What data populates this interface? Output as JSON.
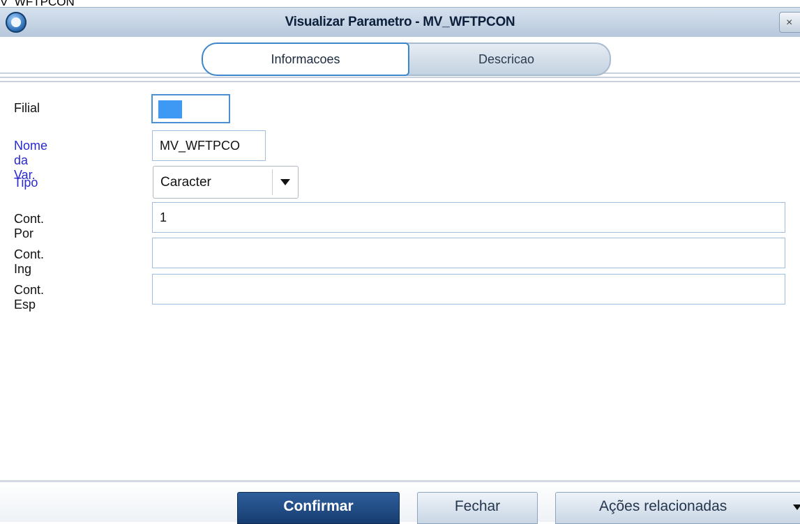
{
  "background_window_title": "V_WFTPCON",
  "dialog": {
    "title": "Visualizar Parametro - MV_WFTPCON",
    "close_glyph": "×"
  },
  "tabs": [
    {
      "label": "Informacoes",
      "active": true
    },
    {
      "label": "Descricao",
      "active": false
    }
  ],
  "form": {
    "filial": {
      "label": "Filial",
      "value": ""
    },
    "nome_var": {
      "label": "Nome da Var.",
      "value": "MV_WFTPCO"
    },
    "tipo": {
      "label": "Tipo",
      "value": "Caracter"
    },
    "cont_por": {
      "label": "Cont. Por",
      "value": "1"
    },
    "cont_ing": {
      "label": "Cont. Ing",
      "value": ""
    },
    "cont_esp": {
      "label": "Cont. Esp",
      "value": ""
    }
  },
  "footer": {
    "confirm_label": "Confirmar",
    "close_label": "Fechar",
    "actions_label": "Ações relacionadas"
  },
  "colors": {
    "required_label": "#2828d4",
    "active_tab_border": "#3c86cc",
    "confirm_bg": "#1f4a82",
    "filial_selection": "#3d99f3"
  },
  "icons": [
    "app-logo-icon",
    "close-icon",
    "chevron-down-icon"
  ]
}
